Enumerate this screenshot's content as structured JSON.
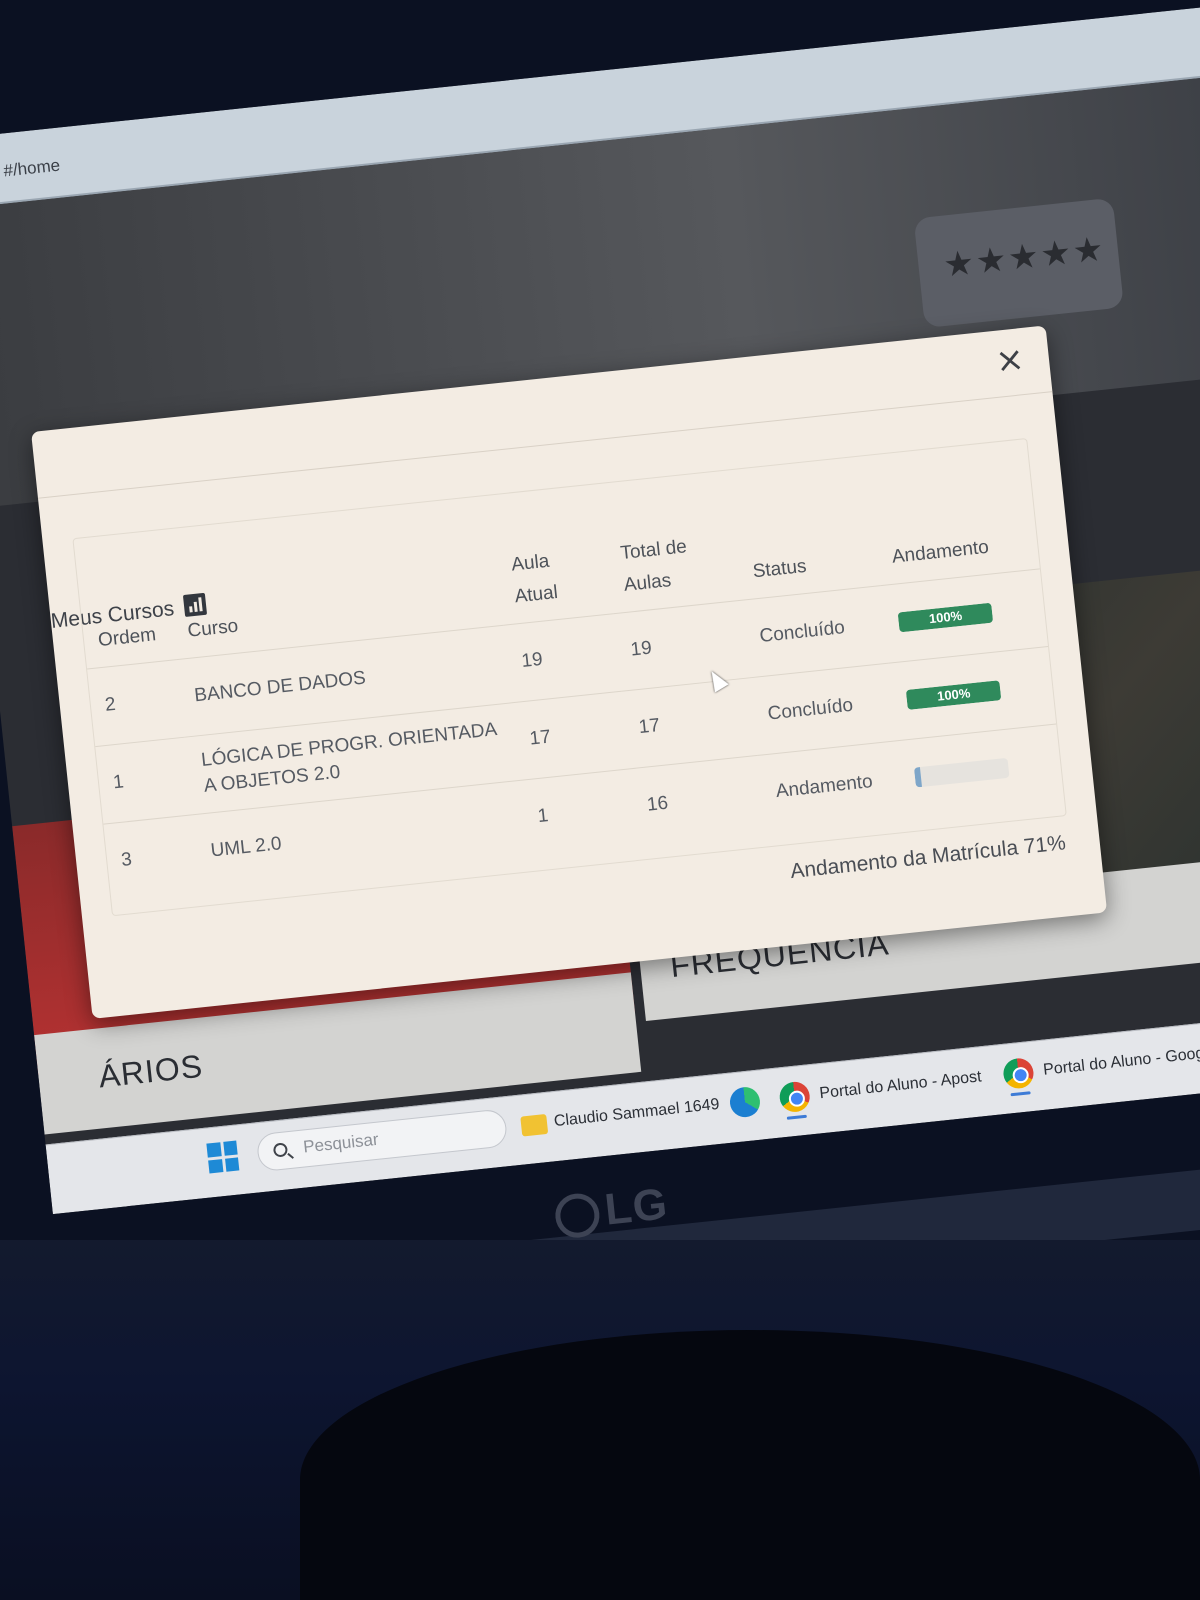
{
  "browser": {
    "url": "#/home"
  },
  "modal": {
    "title": "Meus Cursos",
    "close_symbol": "×",
    "columns": {
      "ordem": "Ordem",
      "curso": "Curso",
      "aula_atual": "Aula Atual",
      "total_aulas": "Total de Aulas",
      "status": "Status",
      "andamento": "Andamento"
    },
    "rows": [
      {
        "ordem": "2",
        "curso": "BANCO DE DADOS",
        "aula_atual": "19",
        "total_aulas": "19",
        "status": "Concluído",
        "andamento_label": "100%",
        "andamento_value": 100
      },
      {
        "ordem": "1",
        "curso": "LÓGICA DE PROGR. ORIENTADA A OBJETOS 2.0",
        "aula_atual": "17",
        "total_aulas": "17",
        "status": "Concluído",
        "andamento_label": "100%",
        "andamento_value": 100
      },
      {
        "ordem": "3",
        "curso": "UML 2.0",
        "aula_atual": "1",
        "total_aulas": "16",
        "status": "Andamento",
        "andamento_label": "",
        "andamento_value": 6
      }
    ],
    "matricula_text": "Andamento da Matrícula 71%"
  },
  "tiles": {
    "left_label": "ÁRIOS",
    "right_label": "FREQUÊNCIA"
  },
  "taskbar": {
    "search_placeholder": "Pesquisar",
    "folder_label": "Claudio Sammael 1649",
    "chrome_window_1": "Portal do Aluno - Apost",
    "chrome_window_2": "Portal do Aluno - Googl"
  },
  "monitor": {
    "brand": "LG"
  },
  "colors": {
    "progress_complete": "#2f8a5c",
    "modal_background": "#f3ece3",
    "windows_accent": "#1e8ad6"
  }
}
